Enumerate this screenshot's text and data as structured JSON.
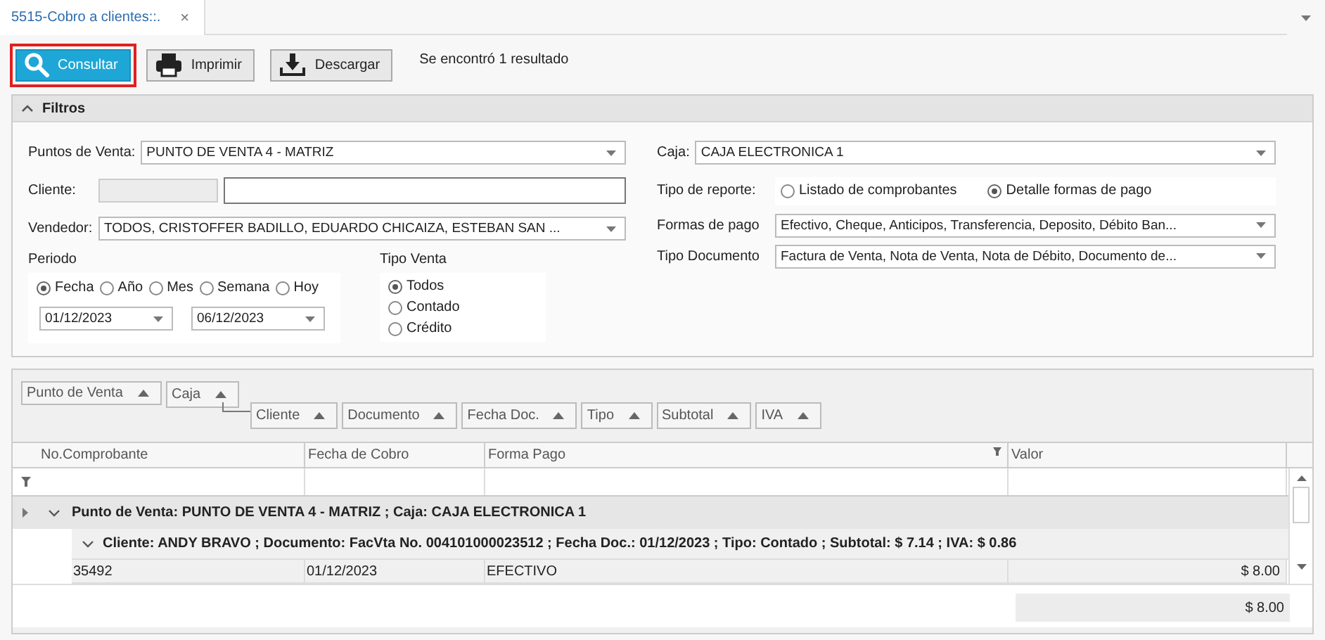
{
  "tabs": [
    {
      "label": "5515-Cobro a clientes::.",
      "selected": true,
      "close": "×"
    }
  ],
  "toolbar": {
    "buttons": [
      {
        "label": "Consultar",
        "kind": "search",
        "focused": true
      },
      {
        "label": "Imprimir",
        "kind": "print",
        "focused": false
      },
      {
        "label": "Descargar",
        "kind": "download",
        "focused": false
      }
    ],
    "status": "Se encontró 1 resultado"
  },
  "filters": {
    "title": "Filtros",
    "expanded": true,
    "puntos_de_venta": {
      "label": "Puntos de Venta:",
      "value": "PUNTO DE VENTA 4 - MATRIZ"
    },
    "cliente": {
      "label": "Cliente:"
    },
    "vendedor": {
      "label": "Vendedor:",
      "value": "TODOS, CRISTOFFER BADILLO, EDUARDO CHICAIZA, ESTEBAN SAN ..."
    },
    "periodo": {
      "label": "Periodo",
      "options": [
        {
          "label": "Fecha",
          "selected": true
        },
        {
          "label": "Año",
          "selected": false
        },
        {
          "label": "Mes",
          "selected": false
        },
        {
          "label": "Semana",
          "selected": false
        },
        {
          "label": "Hoy",
          "selected": false
        }
      ],
      "date_from": "01/12/2023",
      "date_to": "06/12/2023"
    },
    "tipo_venta": {
      "label": "Tipo Venta",
      "options": [
        {
          "label": "Todos",
          "selected": true
        },
        {
          "label": "Contado",
          "selected": false
        },
        {
          "label": "Crédito",
          "selected": false
        }
      ]
    },
    "caja": {
      "label": "Caja:",
      "value": "CAJA ELECTRONICA 1"
    },
    "tipo_reporte": {
      "label": "Tipo de reporte:",
      "options": [
        {
          "label": "Listado de comprobantes",
          "selected": false
        },
        {
          "label": "Detalle formas de pago",
          "selected": true
        }
      ]
    },
    "formas_de_pago": {
      "label": "Formas de pago",
      "value": "Efectivo, Cheque, Anticipos, Transferencia, Deposito, Débito Ban..."
    },
    "tipo_documento": {
      "label": "Tipo Documento",
      "value": "Factura de Venta, Nota de Venta, Nota de Débito, Documento de..."
    }
  },
  "grid": {
    "group_panel": {
      "primary": [
        "Punto de Venta",
        "Caja"
      ],
      "secondary": [
        "Cliente",
        "Documento",
        "Fecha Doc.",
        "Tipo",
        "Subtotal",
        "IVA"
      ]
    },
    "columns": [
      {
        "label": "No.Comprobante",
        "filtered": false
      },
      {
        "label": "Fecha de Cobro",
        "filtered": false
      },
      {
        "label": "Forma Pago",
        "filtered": true
      },
      {
        "label": "Valor",
        "filtered": false
      }
    ],
    "groups": [
      {
        "text": "Punto de Venta: PUNTO DE VENTA 4 - MATRIZ ; Caja: CAJA ELECTRONICA 1",
        "expanded": true,
        "children": [
          {
            "text": "Cliente: ANDY BRAVO ; Documento: FacVta No. 004101000023512 ; Fecha Doc.: 01/12/2023 ; Tipo: Contado ; Subtotal: $ 7.14 ; IVA: $ 0.86",
            "expanded": true,
            "rows": [
              {
                "cells": [
                  "35492",
                  "01/12/2023",
                  "EFECTIVO",
                  "$ 8.00"
                ]
              }
            ]
          }
        ]
      }
    ],
    "total": "$ 8.00"
  }
}
